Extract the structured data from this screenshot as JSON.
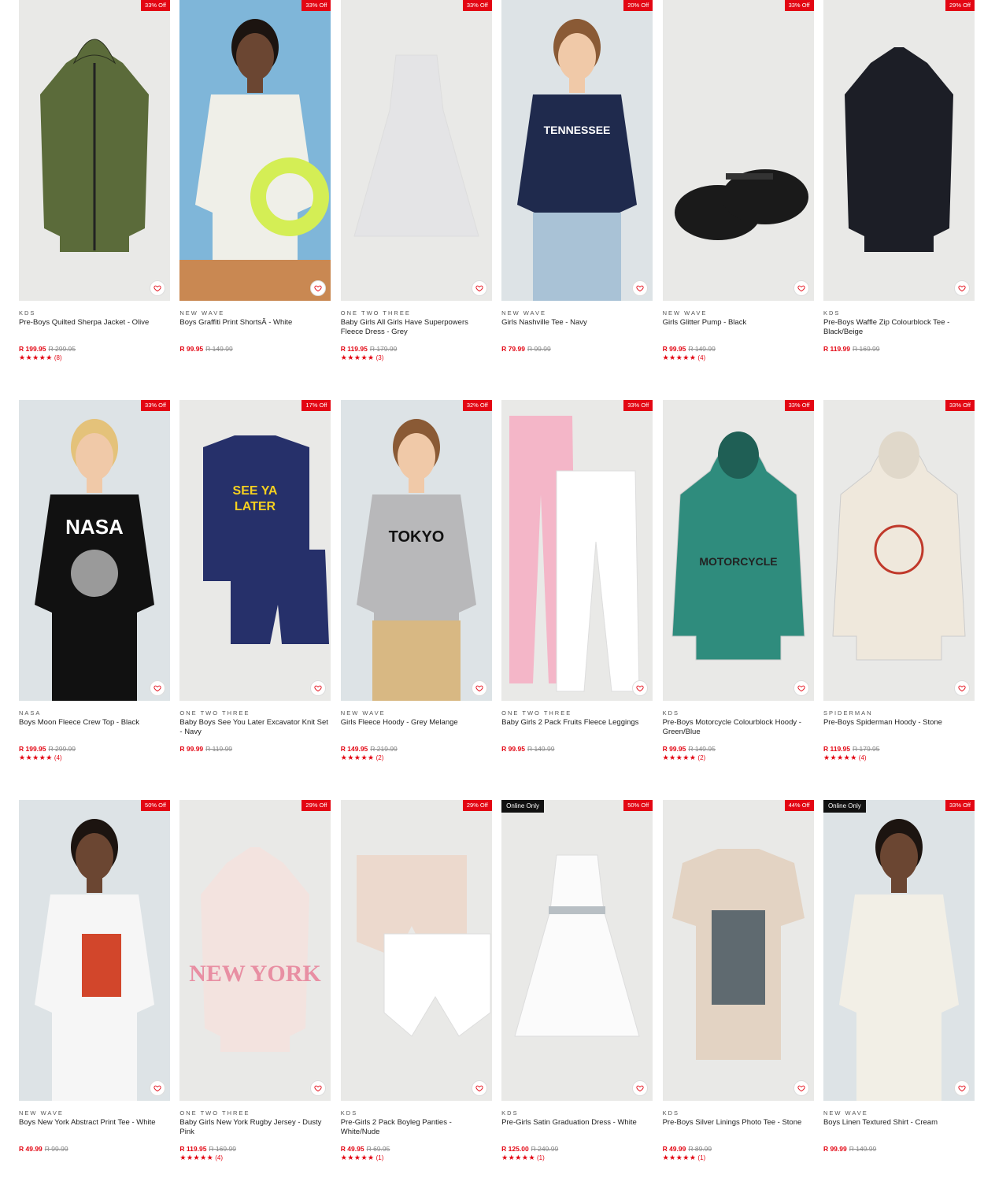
{
  "colors": {
    "accent": "#e30613",
    "online_badge": "#111111",
    "image_bg": "#e9e9e7"
  },
  "products": [
    {
      "brand": "KDS",
      "name": "Pre-Boys Quilted Sherpa Jacket - Olive",
      "price": "R 199.95",
      "was": "R 299.95",
      "badge": "33% Off",
      "online": "",
      "stars": "★★★★★",
      "reviews": "(8)",
      "icon": "olive-jacket",
      "garment": "#5b6b3a"
    },
    {
      "brand": "NEW WAVE",
      "name": "Boys Graffiti Print ShortsÂ - White",
      "price": "R 99.95",
      "was": "R 149.99",
      "badge": "33% Off",
      "online": "",
      "stars": "",
      "reviews": "",
      "icon": "kid-pool-photo",
      "garment": "#efefe8"
    },
    {
      "brand": "ONE TWO THREE",
      "name": "Baby Girls All Girls Have Superpowers Fleece Dress - Grey",
      "price": "R 119.95",
      "was": "R 179.99",
      "badge": "33% Off",
      "online": "",
      "stars": "★★★★★",
      "reviews": "(3)",
      "icon": "grey-dress",
      "garment": "#e4e4e6"
    },
    {
      "brand": "NEW WAVE",
      "name": "Girls Nashville Tee - Navy",
      "price": "R 79.99",
      "was": "R 99.99",
      "badge": "20% Off",
      "online": "",
      "stars": "",
      "reviews": "",
      "icon": "navy-tee-model",
      "garment": "#1f2a4d"
    },
    {
      "brand": "NEW WAVE",
      "name": "Girls Glitter Pump - Black",
      "price": "R 99.95",
      "was": "R 149.99",
      "badge": "33% Off",
      "online": "",
      "stars": "★★★★★",
      "reviews": "(4)",
      "icon": "black-shoes",
      "garment": "#1a1a1a"
    },
    {
      "brand": "KDS",
      "name": "Pre-Boys Waffle Zip Colourblock Tee - Black/Beige",
      "price": "R 119.99",
      "was": "R 169.99",
      "badge": "29% Off",
      "online": "",
      "stars": "",
      "reviews": "",
      "icon": "black-polo",
      "garment": "#1c1e26"
    },
    {
      "brand": "NASA",
      "name": "Boys Moon Fleece Crew Top - Black",
      "price": "R 199.95",
      "was": "R 299.99",
      "badge": "33% Off",
      "online": "",
      "stars": "★★★★★",
      "reviews": "(4)",
      "icon": "nasa-top-model",
      "garment": "#111111"
    },
    {
      "brand": "ONE TWO THREE",
      "name": "Baby Boys See You Later Excavator Knit Set - Navy",
      "price": "R 99.99",
      "was": "R 119.99",
      "badge": "17% Off",
      "online": "",
      "stars": "",
      "reviews": "",
      "icon": "navy-knit-set",
      "garment": "#26306a"
    },
    {
      "brand": "NEW WAVE",
      "name": "Girls Fleece Hoody - Grey Melange",
      "price": "R 149.95",
      "was": "R 219.99",
      "badge": "32% Off",
      "online": "",
      "stars": "★★★★★",
      "reviews": "(2)",
      "icon": "grey-hoody-model",
      "garment": "#b8b8ba"
    },
    {
      "brand": "ONE TWO THREE",
      "name": "Baby Girls 2 Pack Fruits Fleece Leggings",
      "price": "R 99.95",
      "was": "R 149.99",
      "badge": "33% Off",
      "online": "",
      "stars": "",
      "reviews": "",
      "icon": "leggings",
      "garment": "#f4b6c8"
    },
    {
      "brand": "KDS",
      "name": "Pre-Boys Motorcycle Colourblock Hoody - Green/Blue",
      "price": "R 99.95",
      "was": "R 149.95",
      "badge": "33% Off",
      "online": "",
      "stars": "★★★★★",
      "reviews": "(2)",
      "icon": "green-hoody",
      "garment": "#2f8c7d"
    },
    {
      "brand": "SPIDERMAN",
      "name": "Pre-Boys Spiderman Hoody - Stone",
      "price": "R 119.95",
      "was": "R 179.95",
      "badge": "33% Off",
      "online": "",
      "stars": "★★★★★",
      "reviews": "(4)",
      "icon": "stone-hoody",
      "garment": "#efe8dc"
    },
    {
      "brand": "NEW WAVE",
      "name": "Boys New York Abstract Print Tee - White",
      "price": "R 49.99",
      "was": "R 99.99",
      "badge": "50% Off",
      "online": "",
      "stars": "",
      "reviews": "",
      "icon": "white-tee-model",
      "garment": "#f6f6f6"
    },
    {
      "brand": "ONE TWO THREE",
      "name": "Baby Girls New York Rugby Jersey - Dusty Pink",
      "price": "R 119.95",
      "was": "R 169.99",
      "badge": "29% Off",
      "online": "",
      "stars": "★★★★★",
      "reviews": "(4)",
      "icon": "pink-jersey",
      "garment": "#f3e3df"
    },
    {
      "brand": "KDS",
      "name": "Pre-Girls 2 Pack Boyleg Panties - White/Nude",
      "price": "R 49.95",
      "was": "R 69.95",
      "badge": "29% Off",
      "online": "",
      "stars": "★★★★★",
      "reviews": "(1)",
      "icon": "panties",
      "garment": "#ecd9cd"
    },
    {
      "brand": "KDS",
      "name": "Pre-Girls Satin Graduation Dress - White",
      "price": "R 125.00",
      "was": "R 249.99",
      "badge": "50% Off",
      "online": "Online Only",
      "stars": "★★★★★",
      "reviews": "(1)",
      "icon": "white-dress",
      "garment": "#fbfbfb"
    },
    {
      "brand": "KDS",
      "name": "Pre-Boys Silver Linings Photo Tee - Stone",
      "price": "R 49.99",
      "was": "R 89.99",
      "badge": "44% Off",
      "online": "",
      "stars": "★★★★★",
      "reviews": "(1)",
      "icon": "stone-tee",
      "garment": "#e3d3c3"
    },
    {
      "brand": "NEW WAVE",
      "name": "Boys Linen Textured Shirt - Cream",
      "price": "R 99.99",
      "was": "R 149.99",
      "badge": "33% Off",
      "online": "Online Only",
      "stars": "",
      "reviews": "",
      "icon": "cream-shirt-model",
      "garment": "#f2efe6"
    }
  ]
}
